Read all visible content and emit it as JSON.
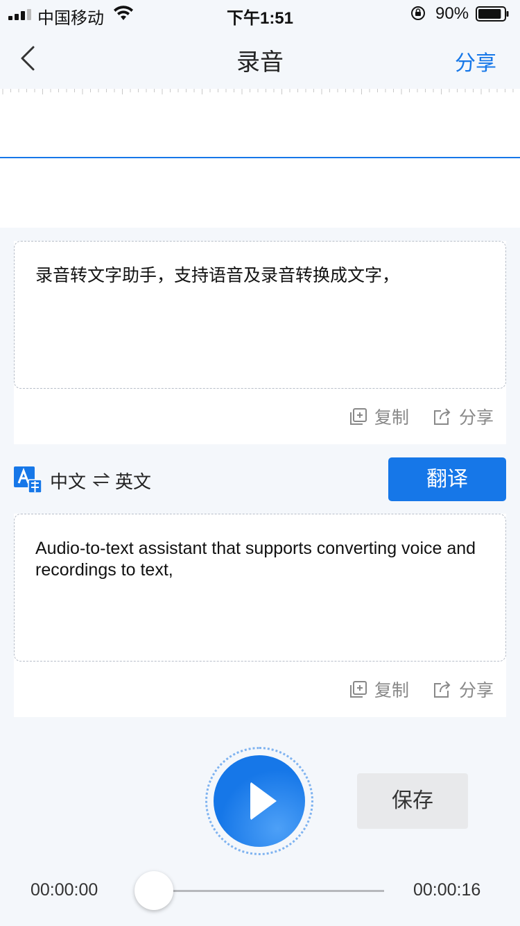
{
  "status_bar": {
    "carrier": "中国移动",
    "time": "下午1:51",
    "battery_percent": "90%",
    "battery_level": 0.9
  },
  "nav": {
    "title": "录音",
    "share_label": "分享"
  },
  "transcript": {
    "text": "录音转文字助手，支持语音及录音转换成文字，",
    "copy_label": "复制",
    "share_label": "分享"
  },
  "translate": {
    "from_lang": "中文",
    "to_lang": "英文",
    "button_label": "翻译"
  },
  "translation": {
    "text": "Audio-to-text assistant that supports converting voice and recordings to text,",
    "copy_label": "复制",
    "share_label": "分享"
  },
  "player": {
    "save_label": "保存",
    "current_time": "00:00:00",
    "total_time": "00:00:16",
    "progress": 0
  },
  "colors": {
    "accent": "#1677e8",
    "background": "#f4f7fb",
    "muted_text": "#888888"
  },
  "icons": {
    "back": "chevron-left-icon",
    "copy": "copy-icon",
    "share": "share-icon",
    "language": "translate-icon",
    "swap": "swap-icon",
    "play": "play-icon"
  }
}
